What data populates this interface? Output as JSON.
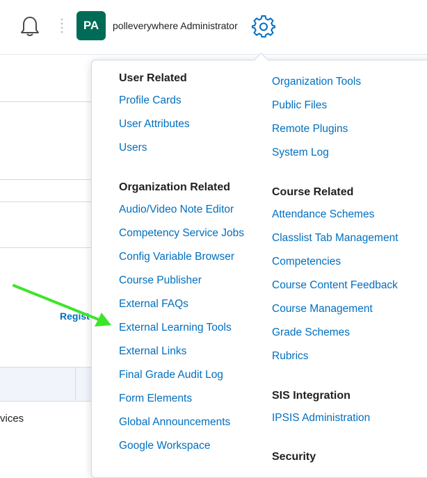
{
  "header": {
    "username": "polleverywhere Administrator",
    "avatar_initials": "PA",
    "avatar_color": "#006b56",
    "icons": [
      "bell-icon",
      "vertical-dots-icon",
      "gear-icon"
    ]
  },
  "background": {
    "partial_link": "Regist",
    "partial_cell": "vices"
  },
  "menu": {
    "link_color": "#006fbf",
    "col1": {
      "user_related": {
        "heading": "User Related",
        "links": [
          "Profile Cards",
          "User Attributes",
          "Users"
        ]
      },
      "organization_related": {
        "heading": "Organization Related",
        "links": [
          "Audio/Video Note Editor",
          "Competency Service Jobs",
          "Config Variable Browser",
          "Course Publisher",
          "External FAQs",
          "External Learning Tools",
          "External Links",
          "Final Grade Audit Log",
          "Form Elements",
          "Global Announcements",
          "Google Workspace"
        ]
      }
    },
    "col2": {
      "org_links": [
        "Organization Tools",
        "Public Files",
        "Remote Plugins",
        "System Log"
      ],
      "course_related": {
        "heading": "Course Related",
        "links": [
          "Attendance Schemes",
          "Classlist Tab Management",
          "Competencies",
          "Course Content Feedback",
          "Course Management",
          "Grade Schemes",
          "Rubrics"
        ]
      },
      "sis_integration": {
        "heading": "SIS Integration",
        "links": [
          "IPSIS Administration"
        ]
      },
      "security": {
        "heading": "Security"
      }
    }
  },
  "annotation": {
    "arrow_color": "#3de52a",
    "points_to": "External Learning Tools"
  }
}
